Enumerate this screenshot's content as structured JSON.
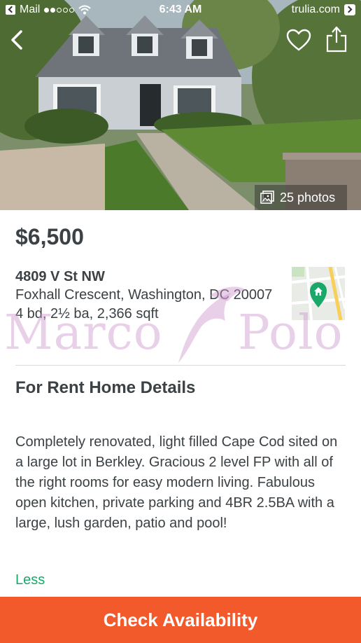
{
  "status_bar": {
    "back_app": "Mail",
    "time": "6:43 AM",
    "url": "trulia.com",
    "signal_dots_filled": 2,
    "signal_dots_total": 5
  },
  "hero": {
    "photos_label": "25 photos"
  },
  "listing": {
    "price": "$6,500",
    "street": "4809 V St NW",
    "locality": "Foxhall Crescent, Washington, DC 20007",
    "specs": "4 bd, 2½ ba, 2,366 sqft"
  },
  "details": {
    "title": "For Rent Home Details",
    "description": "Completely renovated, light filled Cape Cod sited on a large lot in Berkley. Gracious 2 level FP with all of the right rooms for easy modern living. Fabulous open kitchen, private parking and 4BR 2.5BA with a large, lush garden, patio and pool!",
    "less_label": "Less"
  },
  "cta": {
    "label": "Check Availability"
  },
  "watermark": {
    "left_text": "Marco",
    "right_text": "Polo"
  },
  "colors": {
    "accent_green": "#1aa86a",
    "cta_orange": "#f25a2c",
    "text_dark": "#3b4144"
  }
}
